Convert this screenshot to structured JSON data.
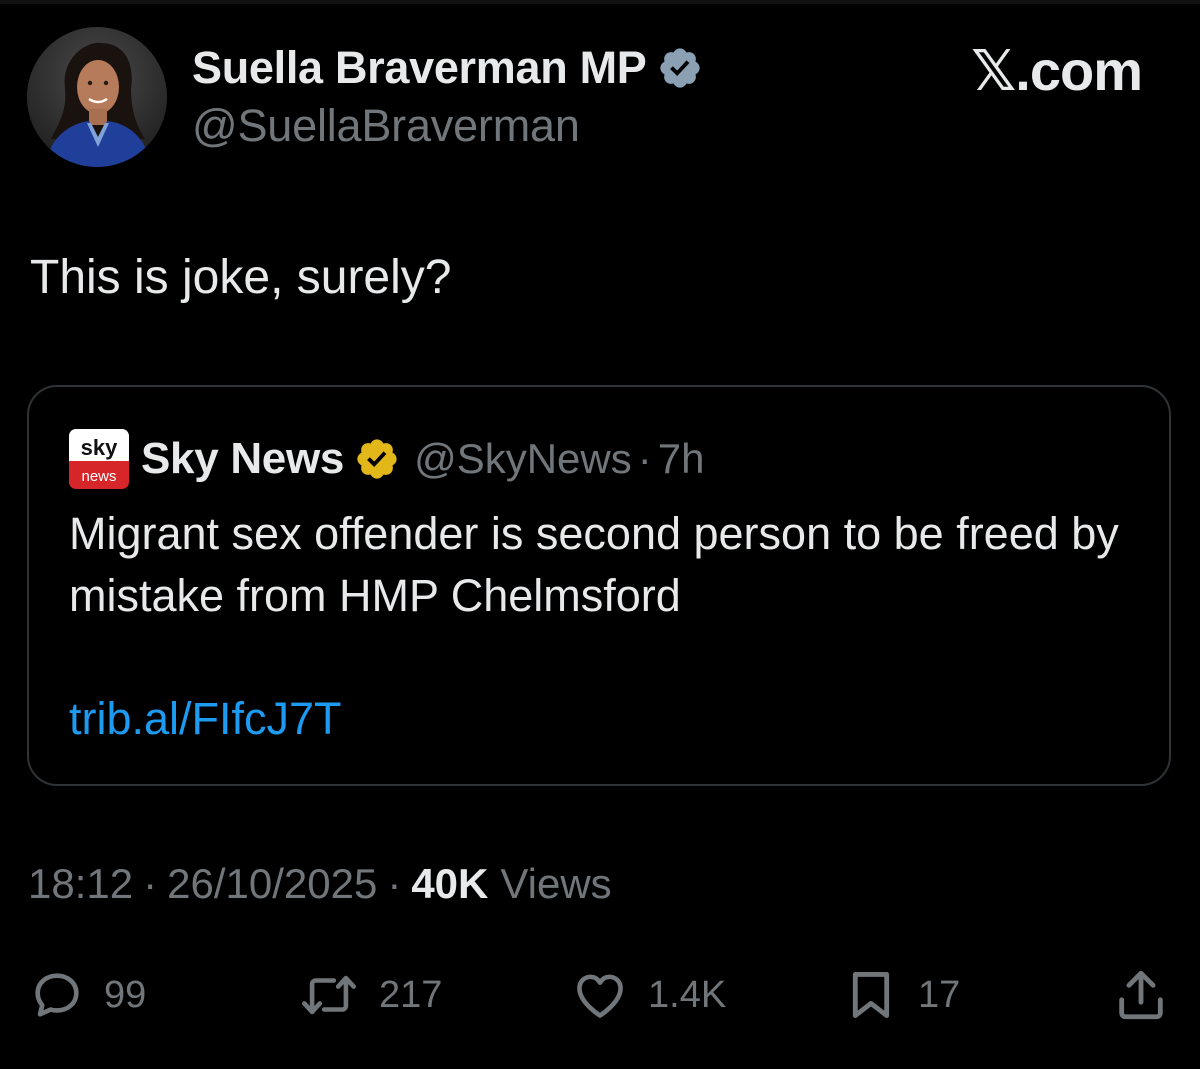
{
  "author": {
    "name": "Suella Braverman MP",
    "handle": "@SuellaBraverman",
    "verified_color": "#8ba0b3"
  },
  "brand": "𝕏.com",
  "tweet": {
    "text": "This is joke, surely?"
  },
  "quote": {
    "logo_text_top": "sky",
    "logo_text_bottom": "news",
    "name": "Sky News",
    "handle": "@SkyNews",
    "dot": "·",
    "time": "7h",
    "verified_color": "#e2b719",
    "body": "Migrant sex offender is second person to be freed by mistake from HMP Chelmsford",
    "link": "trib.al/FIfcJ7T",
    "link_color": "#1d9bf0"
  },
  "meta": {
    "time": "18:12",
    "sep": "·",
    "date": "26/10/2025",
    "views_count": "40K",
    "views_label": "Views"
  },
  "actions": {
    "replies": {
      "icon": "reply-icon",
      "count": "99"
    },
    "reposts": {
      "icon": "repost-icon",
      "count": "217"
    },
    "likes": {
      "icon": "heart-icon",
      "count": "1.4K"
    },
    "bookmarks": {
      "icon": "bookmark-icon",
      "count": "17"
    },
    "share": {
      "icon": "share-icon"
    }
  },
  "colors": {
    "background": "#000000",
    "text": "#e7e9ea",
    "muted": "#71767b",
    "border": "#2f3336"
  }
}
